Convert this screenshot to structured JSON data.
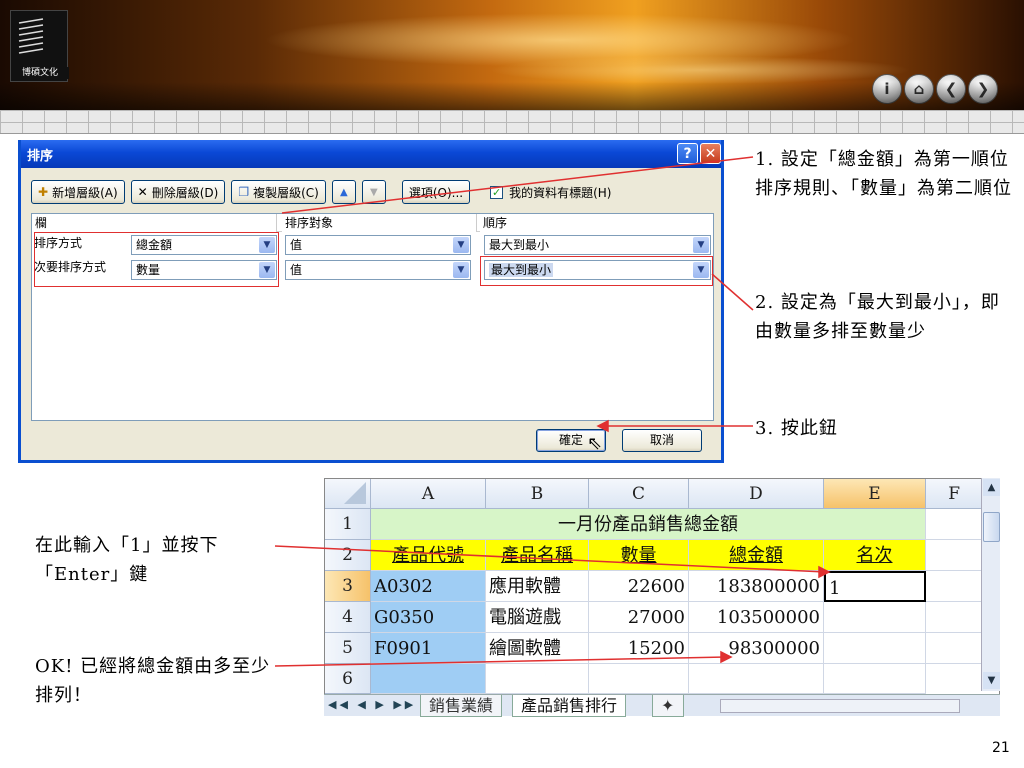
{
  "slide": {
    "logo_text": "博碩文化",
    "nav_icons": [
      "info-icon",
      "home-icon",
      "back-icon",
      "forward-icon"
    ],
    "nav_glyphs": [
      "i",
      "⌂",
      "❮",
      "❯"
    ],
    "page_number": "21"
  },
  "dialog": {
    "title": "排序",
    "help_glyph": "?",
    "close_glyph": "✕",
    "toolbar": {
      "add_level": "新增層級(A)",
      "delete_level": "刪除層級(D)",
      "copy_level": "複製層級(C)",
      "move_up_glyph": "▲",
      "move_down_glyph": "▼",
      "options": "選項(O)...",
      "has_header_label": "我的資料有標題(H)",
      "has_header_checked": true
    },
    "columns": {
      "column": "欄",
      "sort_on": "排序對象",
      "order": "順序"
    },
    "levels": [
      {
        "label": "排序方式",
        "column": "總金額",
        "sort_on": "值",
        "order": "最大到最小"
      },
      {
        "label": "次要排序方式",
        "column": "數量",
        "sort_on": "值",
        "order": "最大到最小"
      }
    ],
    "ok_button": "確定",
    "cancel_button": "取消"
  },
  "annotations": {
    "note1": "1. 設定「總金額」為第一順位排序規則、「數量」為第二順位",
    "note2": "2. 設定為「最大到最小」，即由數量多排至數量少",
    "note3": "3. 按此鈕",
    "note_left1": "在此輸入「1」並按下「Enter」鍵",
    "note_left2": "OK! 已經將總金額由多至少排列！"
  },
  "sheet": {
    "column_headers": [
      "A",
      "B",
      "C",
      "D",
      "E",
      "F"
    ],
    "row_headers": [
      "1",
      "2",
      "3",
      "4",
      "5",
      "6"
    ],
    "title": "一月份產品銷售總金額",
    "headers": [
      "產品代號",
      "產品名稱",
      "數量",
      "總金額",
      "名次"
    ],
    "rows": [
      [
        "A0302",
        "應用軟體",
        "22600",
        "183800000",
        "1"
      ],
      [
        "G0350",
        "電腦遊戲",
        "27000",
        "103500000",
        ""
      ],
      [
        "F0901",
        "繪圖軟體",
        "15200",
        "98300000",
        ""
      ]
    ],
    "tab_nav": "◀◀ ◀ ▶ ▶▶",
    "tabs": [
      "銷售業績",
      "產品銷售排行"
    ],
    "active_tab": 1
  },
  "colors": {
    "title_fill": "#d7f5c8",
    "header_fill": "#ffff00",
    "code_fill": "#9fcdf4",
    "annotation_line": "#e03030"
  }
}
